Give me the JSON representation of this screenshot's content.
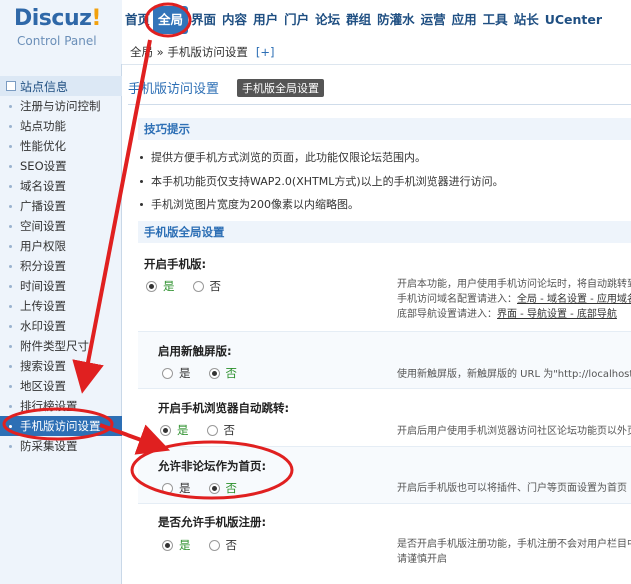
{
  "logo": {
    "main": "Discuz",
    "bang": "!",
    "sub": "Control Panel"
  },
  "topnav": [
    "首页",
    "全局",
    "界面",
    "内容",
    "用户",
    "门户",
    "论坛",
    "群组",
    "防灌水",
    "运营",
    "应用",
    "工具",
    "站长",
    "UCenter"
  ],
  "topnav_active": "全局",
  "breadcrumb": {
    "path": "全局 » 手机版访问设置",
    "plus": "[+]"
  },
  "sidebar": {
    "title": "站点信息",
    "items": [
      "注册与访问控制",
      "站点功能",
      "性能优化",
      "SEO设置",
      "域名设置",
      "广播设置",
      "空间设置",
      "用户权限",
      "积分设置",
      "时间设置",
      "上传设置",
      "水印设置",
      "附件类型尺寸",
      "搜索设置",
      "地区设置",
      "排行榜设置",
      "手机版访问设置",
      "防采集设置"
    ],
    "active": "手机版访问设置"
  },
  "main": {
    "title": "手机版访问设置",
    "tab": "手机版全局设置",
    "tips_title": "技巧提示",
    "tips": [
      "提供方便手机方式浏览的页面，此功能仅限论坛范围内。",
      "本手机功能页仅支持WAP2.0(XHTML方式)以上的手机浏览器进行访问。",
      "手机浏览图片宽度为200像素以内缩略图。"
    ],
    "section_title": "手机版全局设置",
    "settings": [
      {
        "label": "开启手机版:",
        "yes": "是",
        "no": "否",
        "selected": "yes",
        "desc": [
          "开启本功能，用户使用手机访问论坛时，将自动跳转到",
          "手机访问域名配置请进入：",
          "底部导航设置请进入："
        ],
        "links1": "全局 - 域名设置 - 应用域名",
        "links2": "界面 - 导航设置 - 底部导航"
      },
      {
        "label": "启用新触屏版:",
        "yes": "是",
        "no": "否",
        "selected": "no",
        "desc": [
          "使用新触屏版，新触屏版的 URL 为\"http://localhost/"
        ]
      },
      {
        "label": "开启手机浏览器自动跳转:",
        "yes": "是",
        "no": "否",
        "selected": "yes",
        "desc": [
          "开启后用户使用手机浏览器访问社区论坛功能页以外页面"
        ]
      },
      {
        "label": "允许非论坛作为首页:",
        "yes": "是",
        "no": "否",
        "selected": "no",
        "desc": [
          "开启后手机版也可以将插件、门户等页面设置为首页"
        ]
      },
      {
        "label": "是否允许手机版注册:",
        "yes": "是",
        "no": "否",
        "selected": "yes",
        "desc": [
          "是否开启手机版注册功能，手机注册不会对用户栏目中的",
          "请谨慎开启"
        ]
      }
    ]
  },
  "colors": {
    "accent": "#2d6fb5",
    "annotation": "#e02020",
    "selected_option": "#2a8f2a"
  }
}
